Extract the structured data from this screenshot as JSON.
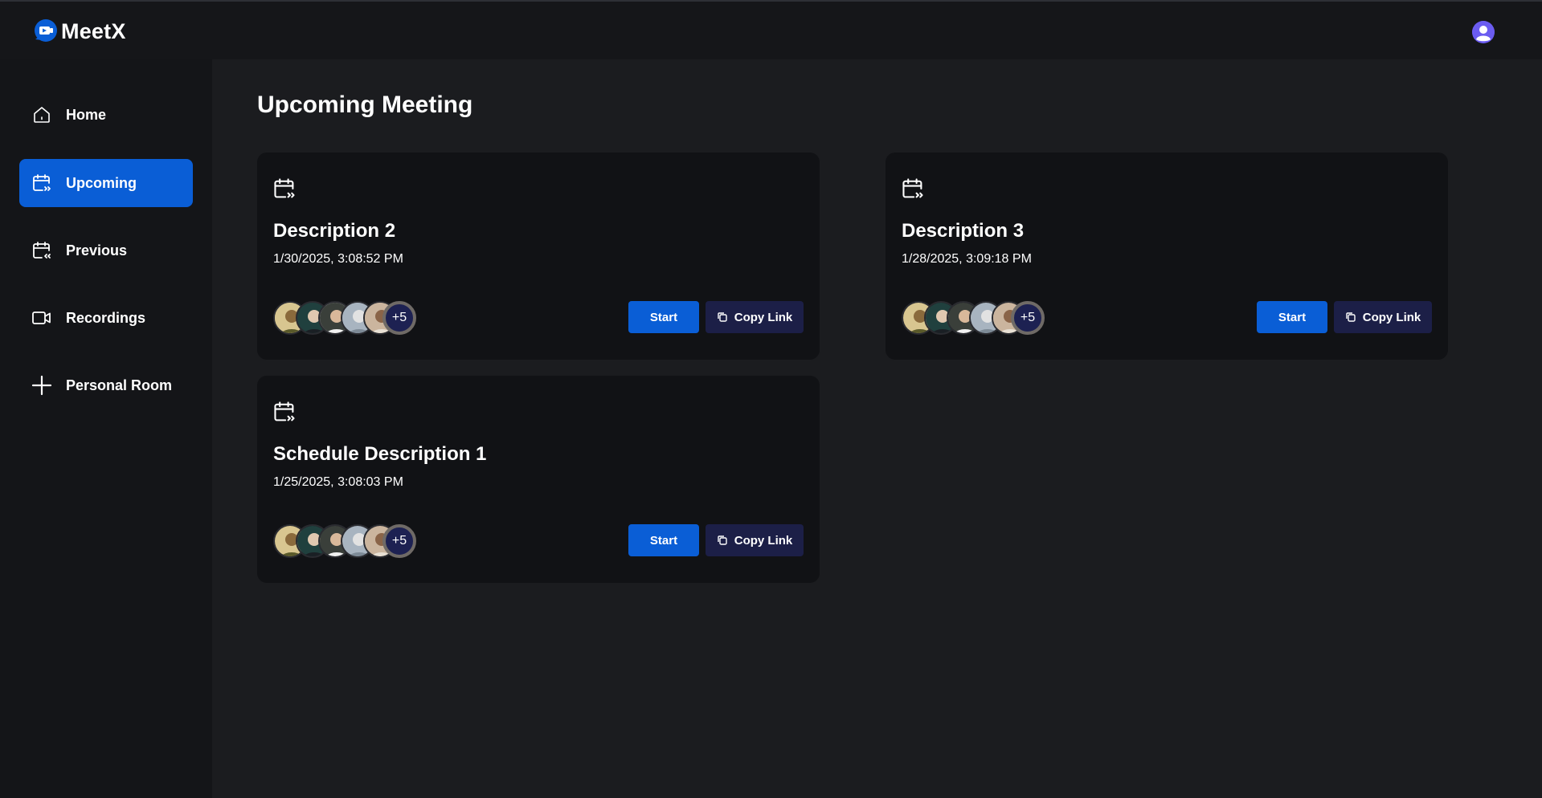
{
  "app": {
    "name": "MeetX"
  },
  "header": {
    "avatar_icon": "user-avatar-icon"
  },
  "sidebar": {
    "items": [
      {
        "label": "Home",
        "icon": "home-icon",
        "active": false
      },
      {
        "label": "Upcoming",
        "icon": "calendar-upcoming-icon",
        "active": true
      },
      {
        "label": "Previous",
        "icon": "calendar-previous-icon",
        "active": false
      },
      {
        "label": "Recordings",
        "icon": "video-icon",
        "active": false
      },
      {
        "label": "Personal Room",
        "icon": "plus-icon",
        "active": false
      }
    ]
  },
  "main": {
    "title": "Upcoming Meeting",
    "cards": [
      {
        "title": "Description 2",
        "date": "1/30/2025, 3:08:52 PM",
        "more_count": "+5",
        "start_label": "Start",
        "copy_label": "Copy Link"
      },
      {
        "title": "Description 3",
        "date": "1/28/2025, 3:09:18 PM",
        "more_count": "+5",
        "start_label": "Start",
        "copy_label": "Copy Link"
      },
      {
        "title": "Schedule Description 1",
        "date": "1/25/2025, 3:08:03 PM",
        "more_count": "+5",
        "start_label": "Start",
        "copy_label": "Copy Link"
      }
    ]
  },
  "colors": {
    "accent": "#0a5ed6",
    "copy_button": "#1c1f47",
    "card_bg": "#111215",
    "main_bg": "#1b1c1f",
    "sidebar_bg": "#141518"
  }
}
